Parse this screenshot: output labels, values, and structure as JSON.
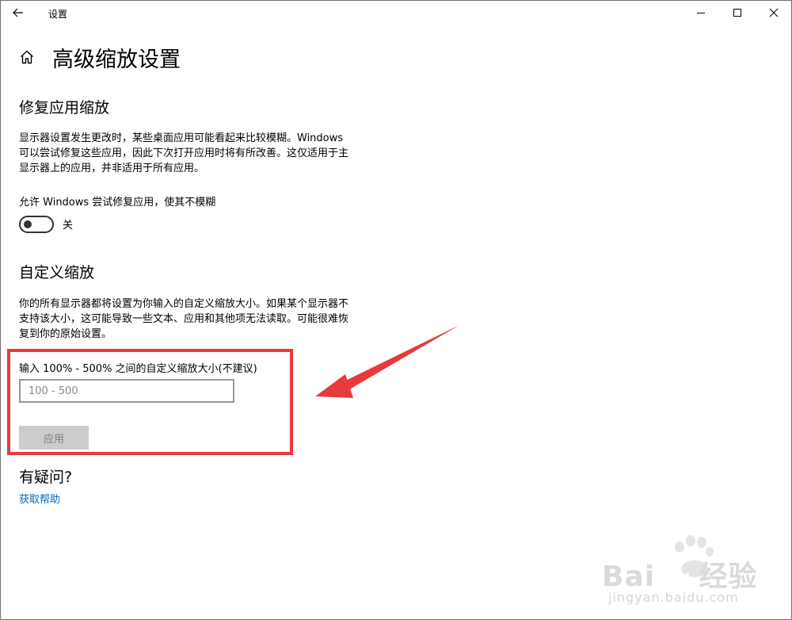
{
  "window": {
    "title": "设置",
    "icons": {
      "back": "back-arrow-icon",
      "minimize": "minimize-icon",
      "maximize": "maximize-icon",
      "close": "close-icon"
    }
  },
  "page": {
    "title": "高级缩放设置",
    "home_icon": "home-icon"
  },
  "fix_scaling": {
    "heading": "修复应用缩放",
    "line1": "显示器设置发生更改时，某些桌面应用可能看起来比较模糊。Windows",
    "line2": "可以尝试修复这些应用，因此下次打开应用时将有所改善。这仅适用于主",
    "line3": "显示器上的应用，并非适用于所有应用。",
    "toggle_label": "允许 Windows 尝试修复应用，使其不模糊",
    "toggle_state": "关",
    "toggle_on": false
  },
  "custom_scaling": {
    "heading": "自定义缩放",
    "line1": "你的所有显示器都将设置为你输入的自定义缩放大小。如果某个显示器不",
    "line2": "支持该大小，这可能导致一些文本、应用和其他项无法读取。可能很难恢",
    "line3": "复到你的原始设置。",
    "input_label": "输入 100% - 500% 之间的自定义缩放大小(不建议)",
    "input_placeholder": "100 - 500",
    "input_value": "",
    "apply_label": "应用"
  },
  "help": {
    "heading": "有疑问?",
    "link": "获取帮助"
  },
  "annotation": {
    "color": "#e83a3a"
  },
  "watermark": {
    "brand": "Bai",
    "brand_paw": "du",
    "suffix": "经验",
    "url": "jingyan.baidu.com"
  },
  "colors": {
    "link": "#0067b8",
    "button_disabled_bg": "#cccccc",
    "annotation_red": "#e83a3a"
  }
}
